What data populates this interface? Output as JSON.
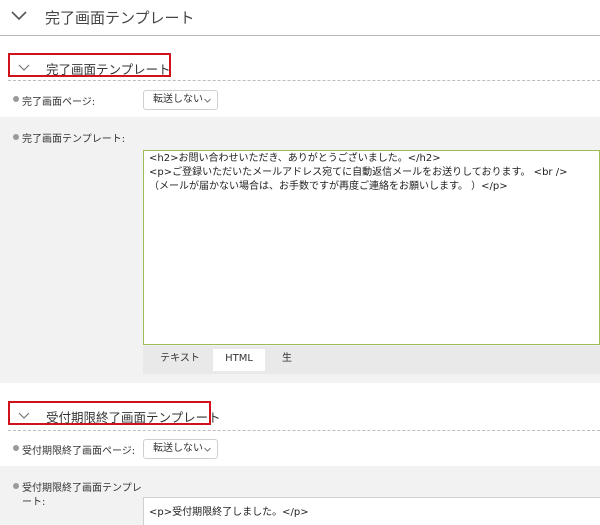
{
  "header": {
    "title": "完了画面テンプレート",
    "toggle_icon": "chevron-down-icon"
  },
  "section1": {
    "title": "完了画面テンプレート",
    "page_label": "完了画面ページ:",
    "page_select_value": "転送しない",
    "template_label": "完了画面テンプレート:",
    "editor_lines": [
      "<h2>お問い合わせいただき、ありがとうございました。</h2>",
      "<p>ご登録いただいたメールアドレス宛てに自動返信メールをお送りしております。 <br />",
      "（メールが届かない場合は、お手数ですが再度ご連絡をお願いします。 ）</p>"
    ],
    "tabs": [
      "テキスト",
      "HTML",
      "生"
    ],
    "active_tab": "HTML"
  },
  "section2": {
    "title": "受付期限終了画面テンプレート",
    "page_label": "受付期限終了画面ページ:",
    "page_select_value": "転送しない",
    "template_label_line1": "受付期限終了画面テンプレ",
    "template_label_line2": "ート:",
    "editor_lines": [
      "<p>受付期限終了しました。</p>"
    ]
  },
  "colors": {
    "highlight_border": "#d0121b",
    "editor_border": "#9cbd54",
    "row_gray": "#f2f2f2",
    "tab_bar": "#e9e9e9"
  }
}
